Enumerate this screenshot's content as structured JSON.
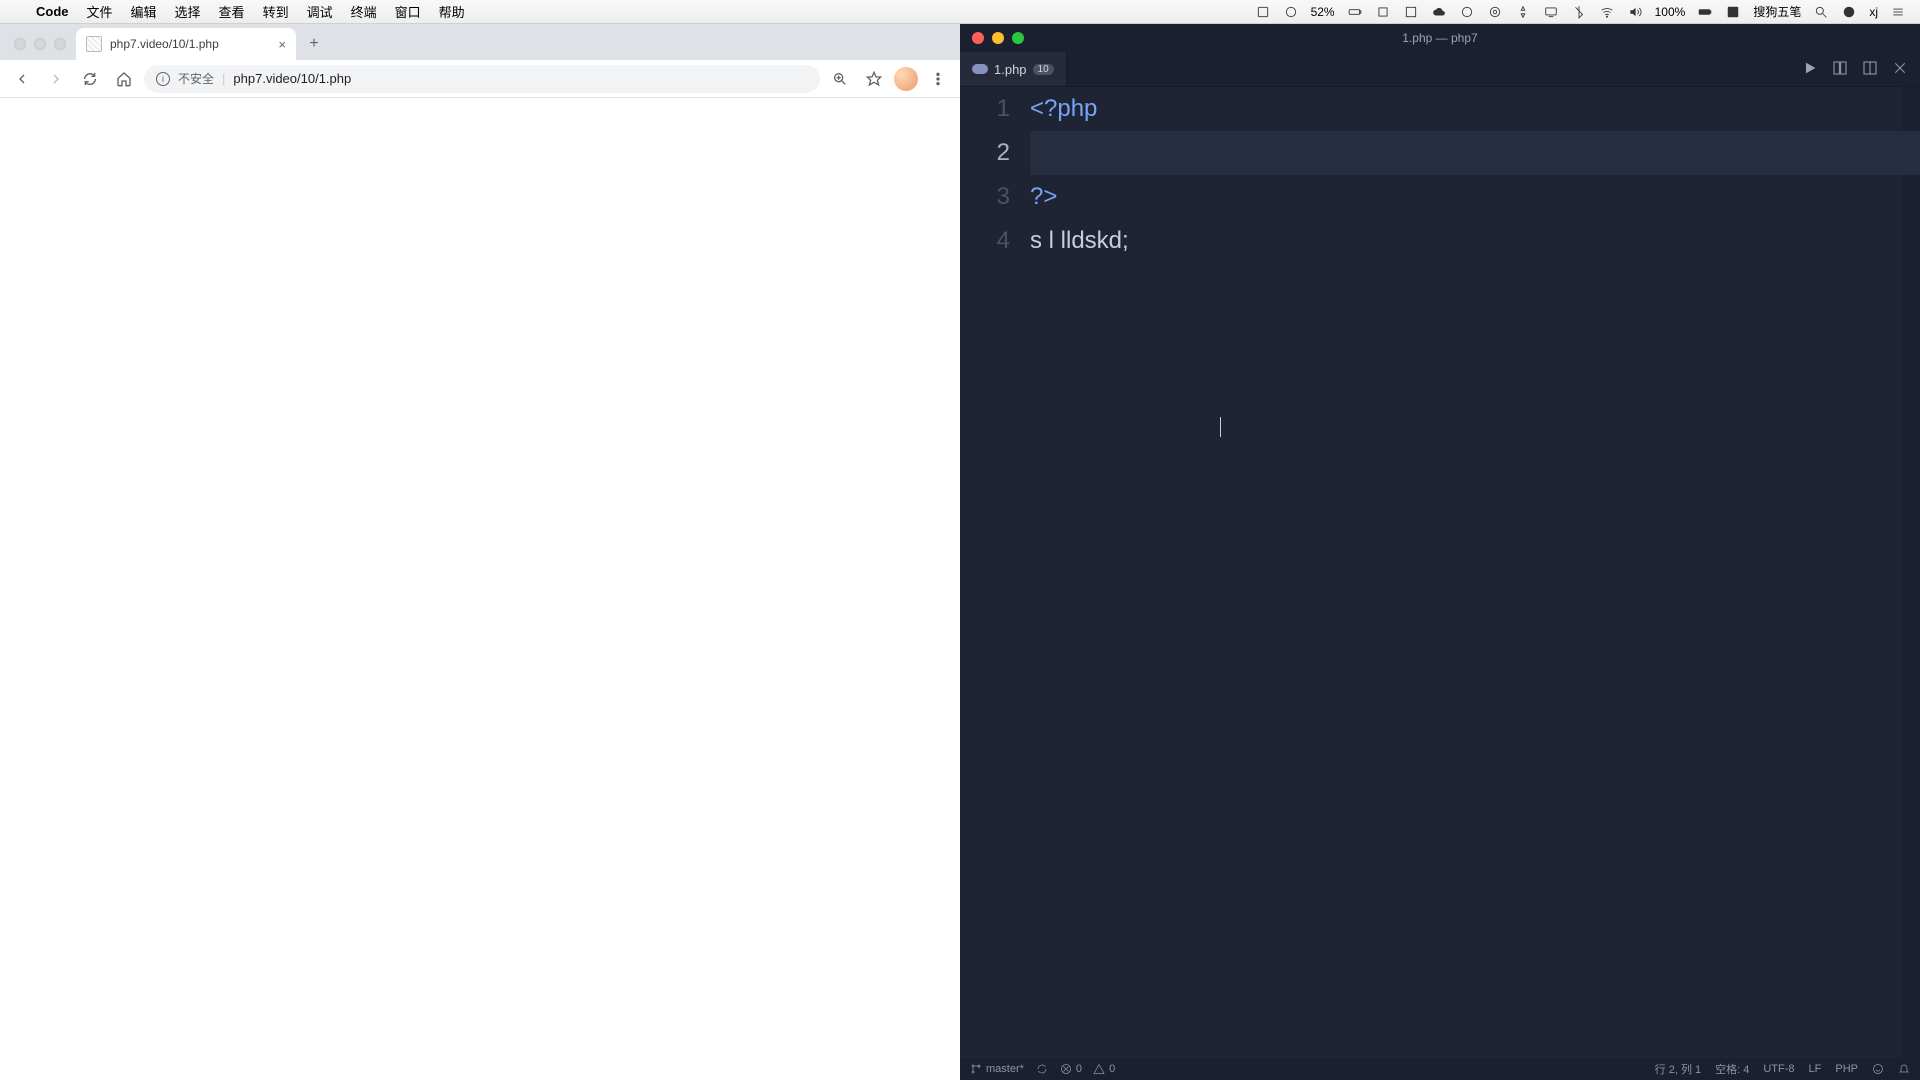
{
  "menubar": {
    "app": "Code",
    "items": [
      "文件",
      "编辑",
      "选择",
      "查看",
      "转到",
      "调试",
      "终端",
      "窗口",
      "帮助"
    ],
    "right": {
      "battery1": "52%",
      "battery2": "100%",
      "ime": "搜狗五笔",
      "user": "xj"
    }
  },
  "chrome": {
    "tab_title": "php7.video/10/1.php",
    "insecure_label": "不安全",
    "url": "php7.video/10/1.php"
  },
  "vscode": {
    "window_title": "1.php — php7",
    "tab_name": "1.php",
    "tab_badge": "10",
    "code_lines": [
      {
        "n": "1",
        "raw": "<?php",
        "cls": "tag"
      },
      {
        "n": "2",
        "raw": "",
        "cls": "cur"
      },
      {
        "n": "3",
        "raw": "?>",
        "cls": "tag"
      },
      {
        "n": "4",
        "raw": "s l lldskd;",
        "cls": "txt"
      }
    ],
    "status": {
      "branch": "master*",
      "errors": "0",
      "warnings": "0",
      "position": "行 2, 列 1",
      "spaces": "空格: 4",
      "encoding": "UTF-8",
      "eol": "LF",
      "lang": "PHP"
    }
  }
}
